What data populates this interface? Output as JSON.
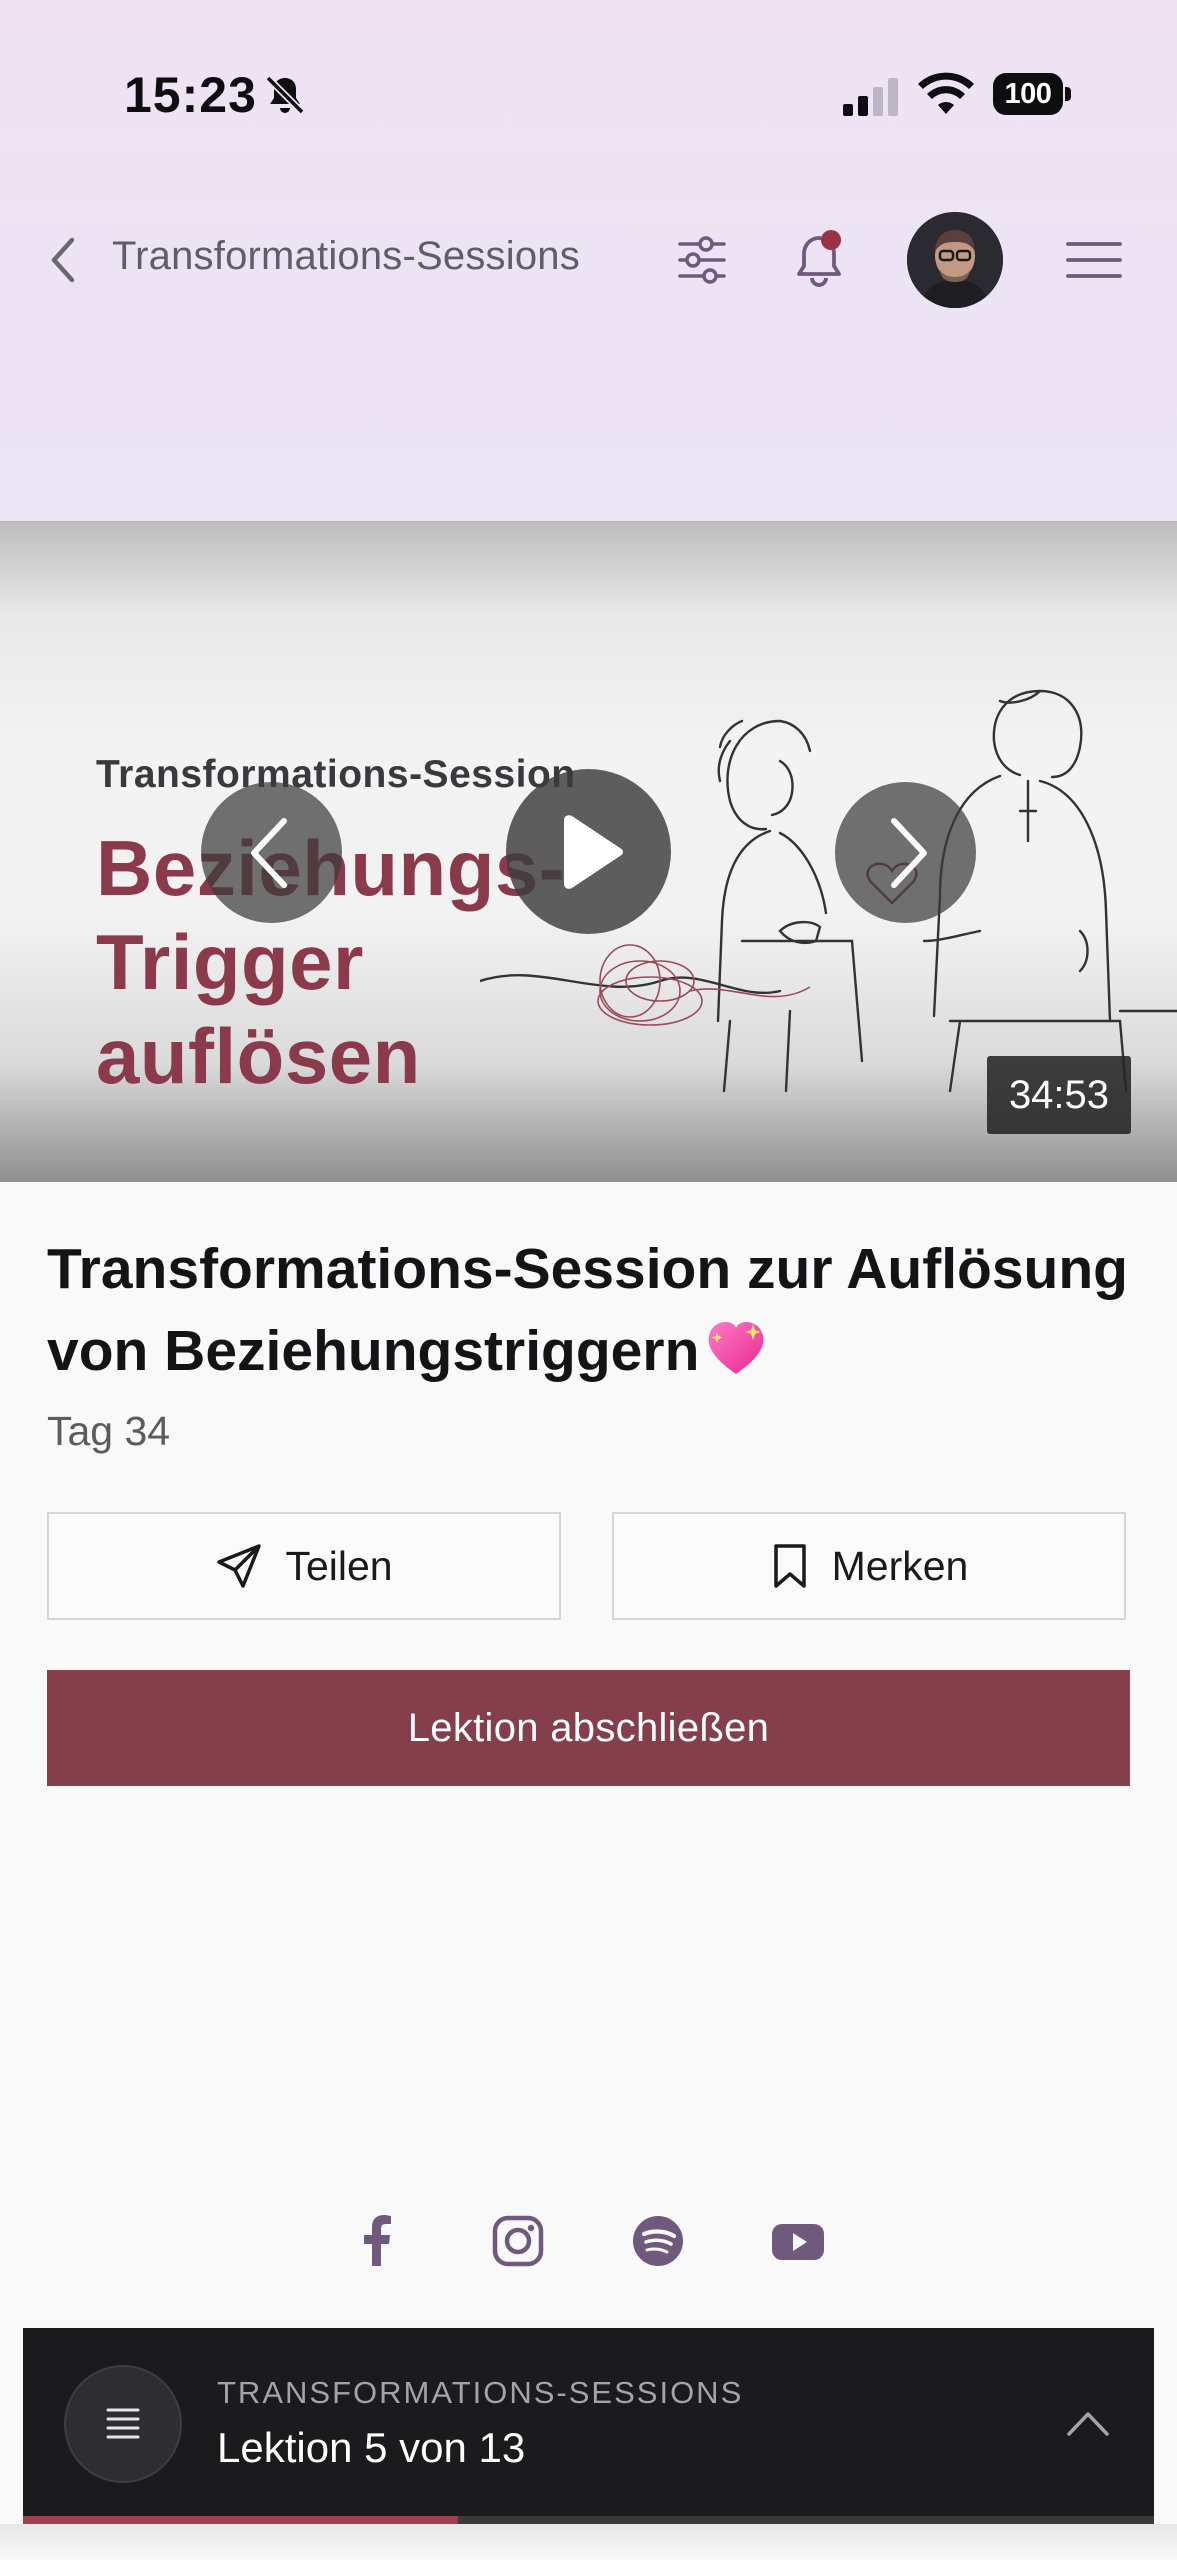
{
  "status_bar": {
    "time": "15:23",
    "battery": "100"
  },
  "header": {
    "back_label": "<",
    "title": "Transformations-Sessions"
  },
  "video": {
    "thumbnail_kicker": "Transformations-Session",
    "thumbnail_title_lines": [
      "Beziehungs-",
      "Trigger",
      "auflösen"
    ],
    "duration": "34:53"
  },
  "lesson": {
    "title": "Transformations-Session zur Auflösung von Beziehungstriggern",
    "day": "Tag 34",
    "share_label": "Teilen",
    "save_label": "Merken",
    "complete_label": "Lektion abschließen"
  },
  "socials": [
    "facebook-icon",
    "instagram-icon",
    "spotify-icon",
    "youtube-icon"
  ],
  "course_bar": {
    "kicker": "TRANSFORMATIONS-SESSIONS",
    "progress_label": "Lektion 5 von 13",
    "progress_fraction": 0.385
  },
  "colors": {
    "accent": "#843f4b",
    "header_bg": "#ede4f4",
    "icon_purple": "#6f5a7e",
    "notification_dot": "#9b3346",
    "bar_bg": "#1b1b1d"
  }
}
